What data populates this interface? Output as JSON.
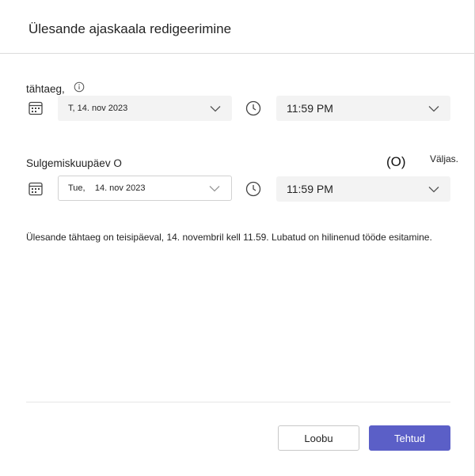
{
  "dialog": {
    "title": "Ülesande ajaskaala redigeerimine"
  },
  "due": {
    "label": "tähtaeg,",
    "date": "T, 14. nov 2023",
    "time": "11:59 PM"
  },
  "close": {
    "label": "Sulgemiskuupäev O",
    "state": "(O)",
    "state_text": "Väljas.",
    "date": "Tue,    14. nov 2023",
    "time": "11:59 PM"
  },
  "info_message": "Ülesande tähtaeg on teisipäeval, 14. novembril kell 11.59. Lubatud on hilinenud tööde esitamine.",
  "footer": {
    "cancel_label": "Loobu",
    "done_label": "Tehtud"
  },
  "colors": {
    "primary_button": "#5b5fc7",
    "field_background": "#f3f3f3"
  },
  "icons": [
    "info-icon",
    "calendar-icon",
    "clock-icon",
    "chevron-down-icon"
  ]
}
